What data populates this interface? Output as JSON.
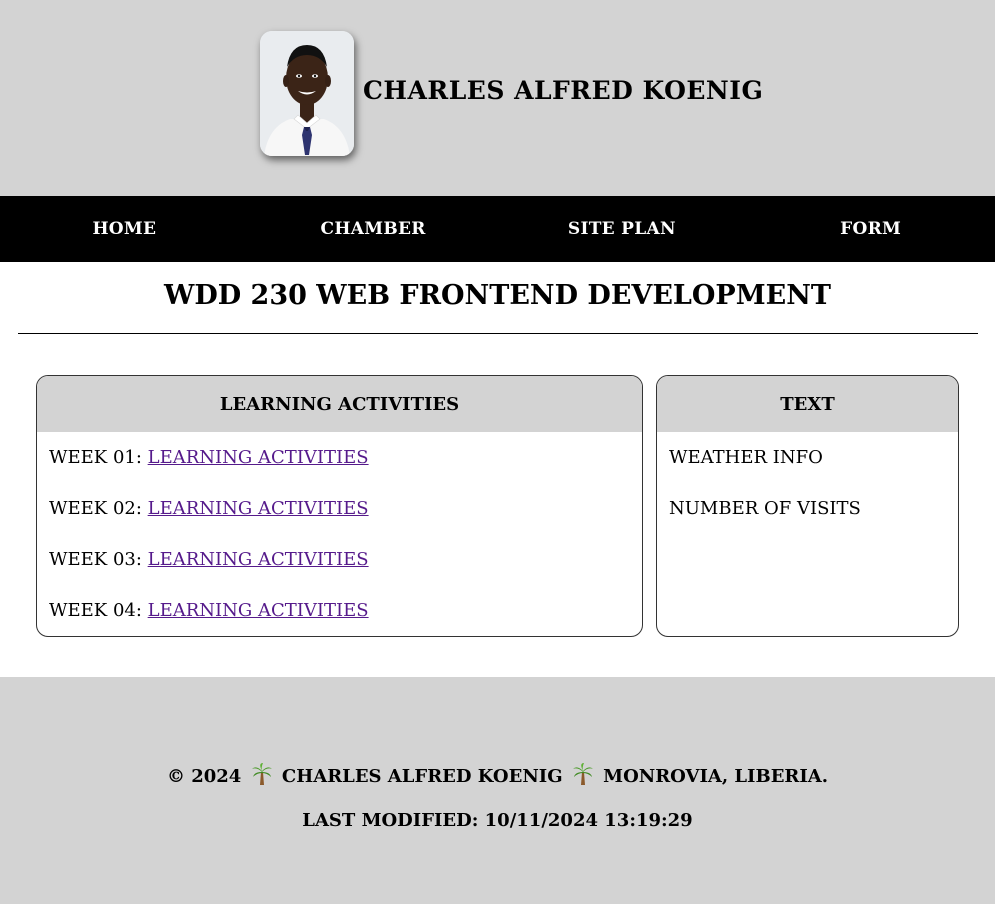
{
  "header": {
    "site_name": "CHARLES ALFRED KOENIG",
    "avatar_icon": "person-photo"
  },
  "nav": {
    "items": [
      {
        "label": "HOME"
      },
      {
        "label": "CHAMBER"
      },
      {
        "label": "SITE PLAN"
      },
      {
        "label": "FORM"
      }
    ]
  },
  "main": {
    "title": "WDD 230 WEB FRONTEND DEVELOPMENT",
    "activities": {
      "heading": "LEARNING ACTIVITIES",
      "weeks": [
        {
          "prefix": "WEEK 01: ",
          "link": "LEARNING ACTIVITIES"
        },
        {
          "prefix": "WEEK 02: ",
          "link": "LEARNING ACTIVITIES"
        },
        {
          "prefix": "WEEK 03: ",
          "link": "LEARNING ACTIVITIES"
        },
        {
          "prefix": "WEEK 04: ",
          "link": "LEARNING ACTIVITIES"
        }
      ]
    },
    "info": {
      "heading": "TEXT",
      "items": [
        "WEATHER INFO",
        "NUMBER OF VISITS"
      ]
    }
  },
  "footer": {
    "copyright_year": "© 2024",
    "name": "CHARLES ALFRED KOENIG",
    "location": "MONROVIA, LIBERIA.",
    "separator_icon": "palm-tree-icon",
    "last_modified_label": "LAST MODIFIED: ",
    "last_modified_value": "10/11/2024 13:19:29"
  },
  "colors": {
    "header_bg": "#d3d3d3",
    "nav_bg": "#000000",
    "link": "#551a8b",
    "footer_bg": "#d3d3d3"
  }
}
